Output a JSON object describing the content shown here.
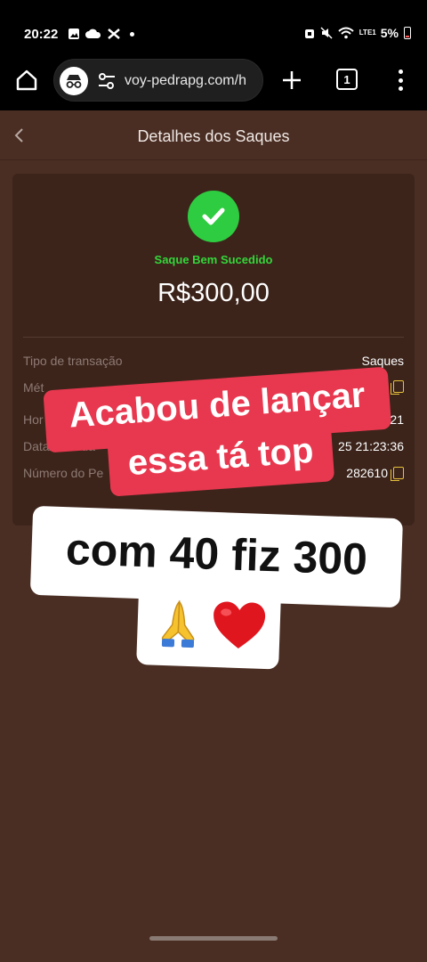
{
  "status_bar": {
    "time": "20:22",
    "battery": "5%",
    "network": "LTE1"
  },
  "browser": {
    "url": "voy-pedrapg.com/h",
    "tab_count": "1"
  },
  "header": {
    "title": "Detalhes dos Saques"
  },
  "card": {
    "status": "Saque Bem Sucedido",
    "amount": "R$300,00",
    "rows": [
      {
        "label": "Tipo de transação",
        "value": "Saques"
      },
      {
        "label": "Mét",
        "value": ""
      },
      {
        "label": "Hor",
        "value": "20:23:21"
      },
      {
        "label": "Data/hora da",
        "value": "25 21:23:36"
      },
      {
        "label": "Número do Pe",
        "value": "282610"
      }
    ]
  },
  "overlay": {
    "red_line1": "Acabou de lançar",
    "red_line2": "essa tá top",
    "white_line1": "com 40 fiz 300",
    "emojis": [
      "praying-hands",
      "red-heart"
    ]
  },
  "colors": {
    "page_bg": "#4a2e23",
    "card_bg": "#3c241b",
    "success": "#2ecc40",
    "copy_accent": "#e7c13c",
    "sticker_red": "#e8384f"
  }
}
